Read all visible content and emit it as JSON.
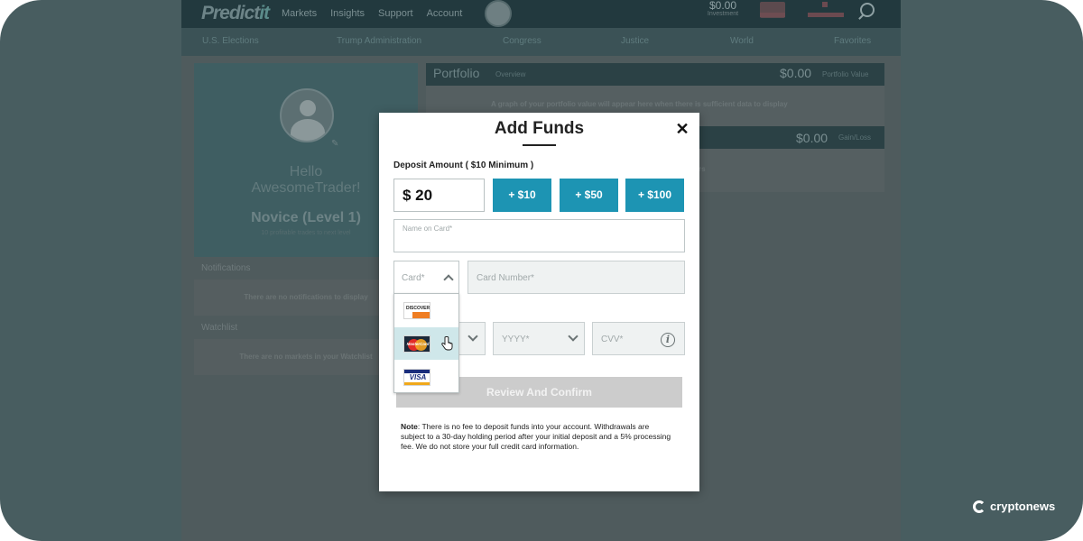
{
  "site": {
    "logo_text": "Predict",
    "logo_accent": "it",
    "nav": [
      "Markets",
      "Insights",
      "Support",
      "Account"
    ],
    "stat_invested_value": "$0.00",
    "stat_invested_label": "Investment",
    "categories": [
      "U.S. Elections",
      "Trump Administration",
      "Congress",
      "Justice",
      "World",
      "Favorites"
    ]
  },
  "profile": {
    "greeting": "Hello",
    "username": "AwesomeTrader!",
    "level": "Novice (Level 1)",
    "level_sub": "10 profitable trades to next level"
  },
  "notifications": {
    "title": "Notifications",
    "empty": "There are no notifications to display"
  },
  "watchlist": {
    "title": "Watchlist",
    "empty": "There are no markets in your Watchlist"
  },
  "portfolio": {
    "title": "Portfolio",
    "subtitle": "Overview",
    "value": "$0.00",
    "value_label": "Portfolio Value",
    "graph_message": "A graph of your portfolio value will appear here when there is sufficient data to display",
    "gain_value": "$0.00",
    "gain_label": "Gain/Loss",
    "gain_fragment": "rs"
  },
  "modal": {
    "title": "Add Funds",
    "close_symbol": "✕",
    "deposit_label": "Deposit Amount ( $10 Minimum )",
    "amount_value": "$ 20",
    "quick_add": [
      "+ $10",
      "+ $50",
      "+ $100"
    ],
    "name_placeholder": "Name on Card*",
    "card_type_placeholder": "Card*",
    "card_number_placeholder": "Card Number*",
    "year_placeholder": "YYYY*",
    "cvv_placeholder": "CVV*",
    "info_symbol": "i",
    "review_label": "Review And Confirm",
    "note_label": "Note",
    "note_text": ": There is no fee to deposit funds into your account. Withdrawals are subject to a 30-day holding period after your initial deposit and a 5% processing fee. We do not store your full credit card information.",
    "card_options": [
      "DISCOVER",
      "MasterCard",
      "VISA"
    ]
  },
  "watermark": "cryptonews",
  "colors": {
    "accent": "#1d94b3",
    "disabled_button": "#cccccc",
    "dropdown_highlight": "#cfe7ea",
    "overlay": "#485d60"
  },
  "icons": [
    "search-icon",
    "avatar-icon",
    "edit-icon",
    "close-icon",
    "chevron-up-icon",
    "chevron-down-icon",
    "info-icon",
    "pointer-cursor-icon",
    "cryptonews-logo-icon"
  ]
}
